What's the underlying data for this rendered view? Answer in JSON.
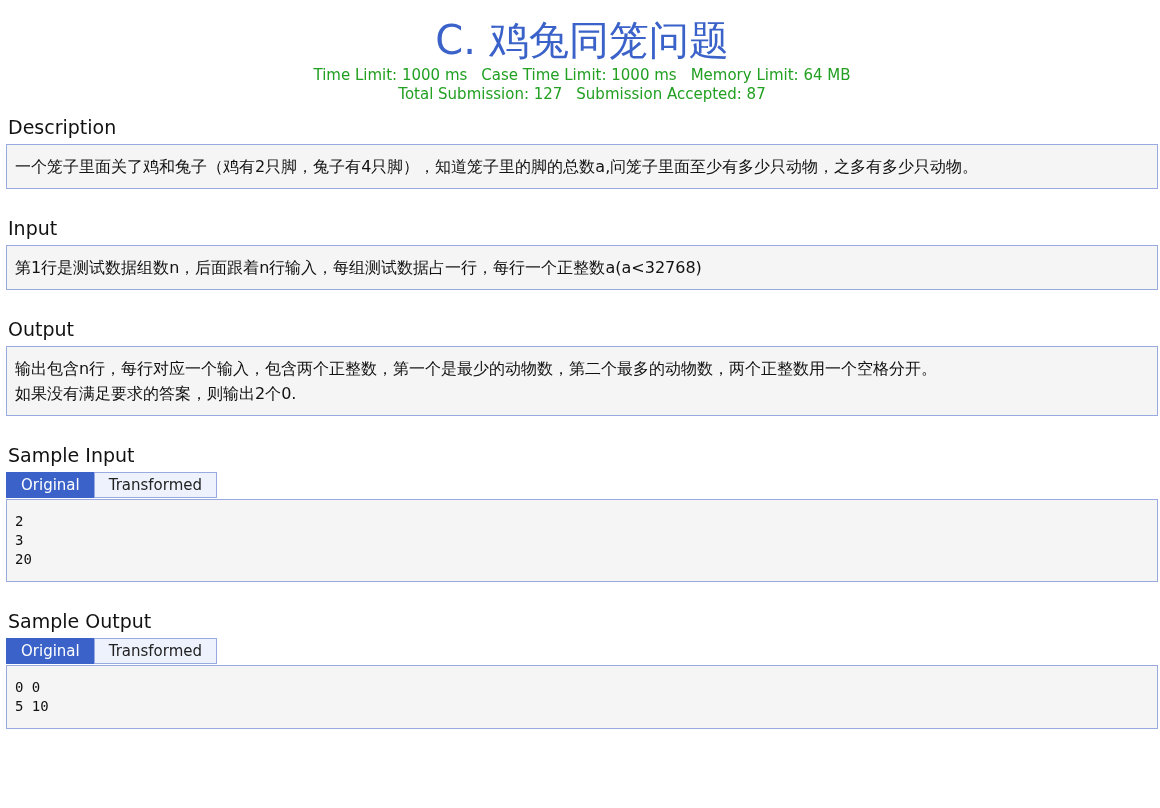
{
  "title": "C. 鸡兔同笼问题",
  "limits": [
    {
      "text": "Time Limit: 1000 ms"
    },
    {
      "text": "Case Time Limit: 1000 ms"
    },
    {
      "text": "Memory Limit: 64 MB"
    }
  ],
  "stats": [
    {
      "text": "Total Submission: 127"
    },
    {
      "text": "Submission Accepted: 87"
    }
  ],
  "sections": [
    {
      "kind": "text",
      "heading": "Description",
      "paragraphs": [
        "一个笼子里面关了鸡和兔子（鸡有2只脚，兔子有4只脚），知道笼子里的脚的总数a,问笼子里面至少有多少只动物，之多有多少只动物。"
      ]
    },
    {
      "kind": "text",
      "heading": "Input",
      "paragraphs": [
        "第1行是测试数据组数n，后面跟着n行输入，每组测试数据占一行，每行一个正整数a(a<32768)"
      ]
    },
    {
      "kind": "text",
      "heading": "Output",
      "paragraphs": [
        "输出包含n行，每行对应一个输入，包含两个正整数，第一个是最少的动物数，第二个最多的动物数，两个正整数用一个空格分开。",
        "如果没有满足要求的答案，则输出2个0."
      ]
    },
    {
      "kind": "sample",
      "heading": "Sample Input",
      "tabs": [
        {
          "label": "Original",
          "selected": true
        },
        {
          "label": "Transformed",
          "selected": false
        }
      ],
      "lines": [
        "2",
        "3",
        "20"
      ]
    },
    {
      "kind": "sample",
      "heading": "Sample Output",
      "tabs": [
        {
          "label": "Original",
          "selected": true
        },
        {
          "label": "Transformed",
          "selected": false
        }
      ],
      "lines": [
        "0 0",
        "5 10"
      ]
    }
  ]
}
